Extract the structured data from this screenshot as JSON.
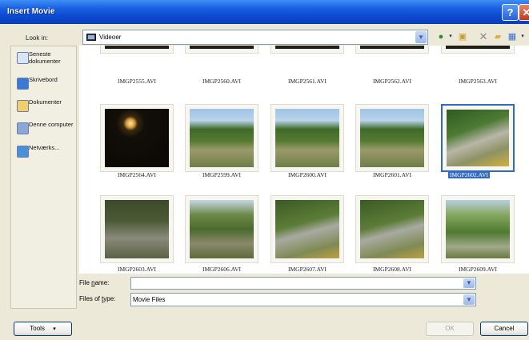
{
  "window": {
    "title": "Insert Movie"
  },
  "lookin": {
    "label": "Look in:",
    "value": "Videoer"
  },
  "toolbar": {
    "icons": [
      "back-icon",
      "up-folder-icon",
      "delete-icon",
      "new-folder-icon",
      "views-icon"
    ]
  },
  "places": [
    {
      "label": "Seneste dokumenter",
      "icon": "recent-documents-icon",
      "color": "#d9e4f7"
    },
    {
      "label": "Skrivebord",
      "icon": "desktop-icon",
      "color": "#3a7ad6"
    },
    {
      "label": "Dokumenter",
      "icon": "documents-folder-icon",
      "color": "#f2cf6a"
    },
    {
      "label": "Denne computer",
      "icon": "computer-icon",
      "color": "#8aa8d6"
    },
    {
      "label": "Netværks...",
      "icon": "network-icon",
      "color": "#4a8fd8"
    }
  ],
  "files": [
    {
      "name": "IMGP2555.AVI",
      "scene": "dark",
      "selected": false
    },
    {
      "name": "IMGP2560.AVI",
      "scene": "dark",
      "selected": false
    },
    {
      "name": "IMGP2561.AVI",
      "scene": "dark",
      "selected": false
    },
    {
      "name": "IMGP2562.AVI",
      "scene": "dark",
      "selected": false
    },
    {
      "name": "IMGP2563.AVI",
      "scene": "dark",
      "selected": false
    },
    {
      "name": "IMGP2564.AVI",
      "scene": "night-light",
      "selected": false
    },
    {
      "name": "IMGP2599.AVI",
      "scene": "track-sky",
      "selected": false
    },
    {
      "name": "IMGP2600.AVI",
      "scene": "track-sky",
      "selected": false
    },
    {
      "name": "IMGP2601.AVI",
      "scene": "track-sky",
      "selected": false
    },
    {
      "name": "IMGP2602.AVI",
      "scene": "track-slope",
      "selected": true
    },
    {
      "name": "IMGP2603.AVI",
      "scene": "track-dim",
      "selected": false
    },
    {
      "name": "IMGP2606.AVI",
      "scene": "track-trees",
      "selected": false
    },
    {
      "name": "IMGP2607.AVI",
      "scene": "track-rails",
      "selected": false
    },
    {
      "name": "IMGP2608.AVI",
      "scene": "track-rails",
      "selected": false
    },
    {
      "name": "IMGP2609.AVI",
      "scene": "track-person",
      "selected": false
    }
  ],
  "filename": {
    "label_pre": "File ",
    "label_u": "n",
    "label_post": "ame:",
    "value": ""
  },
  "filetype": {
    "label_pre": "Files of ",
    "label_u": "t",
    "label_post": "ype:",
    "value": "Movie Files"
  },
  "buttons": {
    "tools": "Tools",
    "ok": "OK",
    "cancel": "Cancel"
  },
  "colors": {
    "selection": "#316ac5",
    "titlebar": "#0b49cf",
    "dialog": "#ece9d8"
  }
}
